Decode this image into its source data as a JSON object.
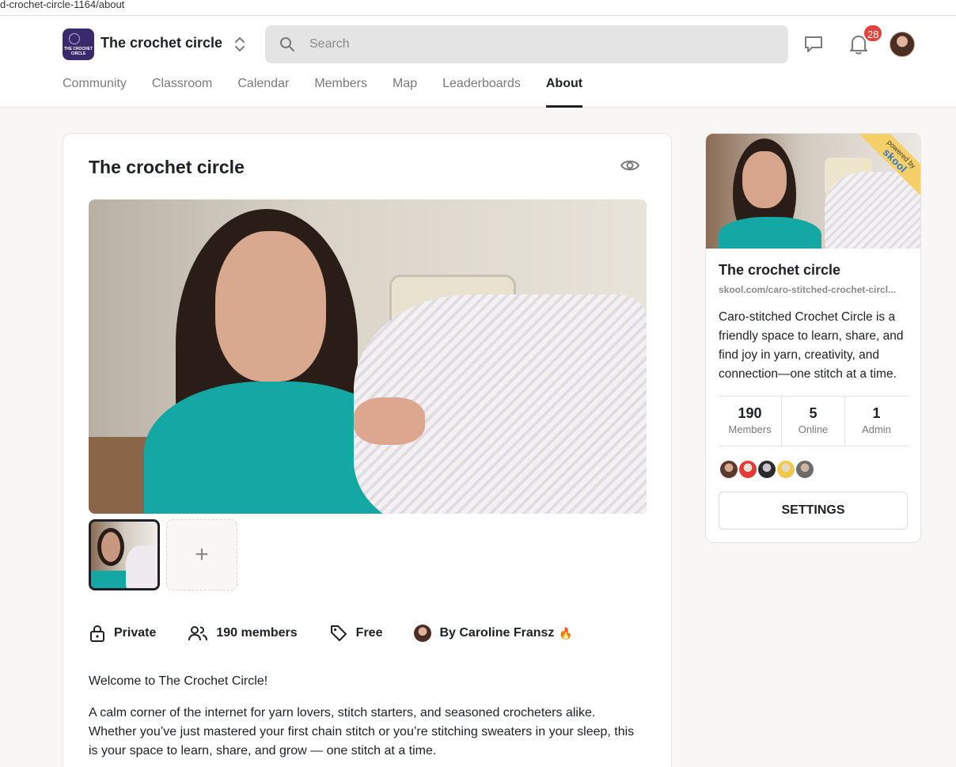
{
  "browser": {
    "url_fragment": "d-crochet-circle-1164/about"
  },
  "header": {
    "logo_text": "THE CROCHET CIRCLE",
    "group_name": "The crochet circle",
    "search_placeholder": "Search",
    "notification_count": "28"
  },
  "nav": {
    "items": [
      {
        "label": "Community"
      },
      {
        "label": "Classroom"
      },
      {
        "label": "Calendar"
      },
      {
        "label": "Members"
      },
      {
        "label": "Map"
      },
      {
        "label": "Leaderboards"
      },
      {
        "label": "About",
        "active": true
      }
    ]
  },
  "main": {
    "title": "The crochet circle",
    "add_media_label": "+",
    "meta": {
      "privacy": "Private",
      "members": "190 members",
      "price": "Free",
      "owner": "By Caroline Fransz",
      "owner_badge": "🔥"
    },
    "description": [
      "Welcome to The Crochet Circle!",
      "A calm corner of the internet for yarn lovers, stitch starters, and seasoned crocheters alike. Whether you’ve just mastered your first chain stitch or you’re stitching sweaters in your sleep, this is your space to learn, share, and grow — one stitch at a time."
    ]
  },
  "sidebar": {
    "ribbon_top": "powered by",
    "ribbon_brand": "skool",
    "title": "The crochet circle",
    "url": "skool.com/caro-stitched-crochet-circl...",
    "description": "Caro-stitched Crochet Circle is a friendly space to learn, share, and find joy in yarn, creativity, and connection—one stitch at a time.",
    "stats": [
      {
        "value": "190",
        "label": "Members"
      },
      {
        "value": "5",
        "label": "Online"
      },
      {
        "value": "1",
        "label": "Admin"
      }
    ],
    "settings_label": "SETTINGS"
  },
  "colors": {
    "accent_dark": "#202124",
    "badge_red": "#e0433b",
    "ribbon_yellow": "#f5cf68",
    "shirt_teal": "#14a7a3",
    "logo_purple": "#3a2a6b"
  }
}
